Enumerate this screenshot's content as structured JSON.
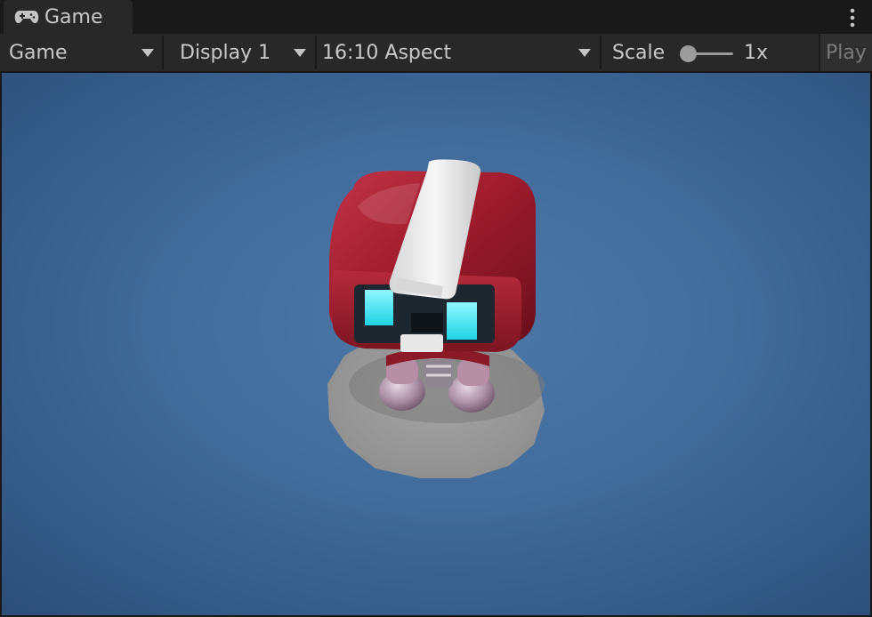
{
  "tab": {
    "label": "Game",
    "icon": "gamepad-icon"
  },
  "toolbar": {
    "mode_label": "Game",
    "display_label": "Display 1",
    "aspect_label": "16:10 Aspect",
    "scale_label": "Scale",
    "scale_value": "1x",
    "play_label": "Play"
  },
  "viewport": {
    "background_color": "#416b9a",
    "subject": "red-robot-character-on-round-pedestal"
  },
  "colors": {
    "panel": "#282828",
    "tabbar": "#191919",
    "text": "#c8c8c8",
    "robot_red": "#9e1e2c",
    "robot_white": "#eeeeee",
    "eye_cyan": "#3ee4ee",
    "pedestal": "#9a9a9a"
  }
}
